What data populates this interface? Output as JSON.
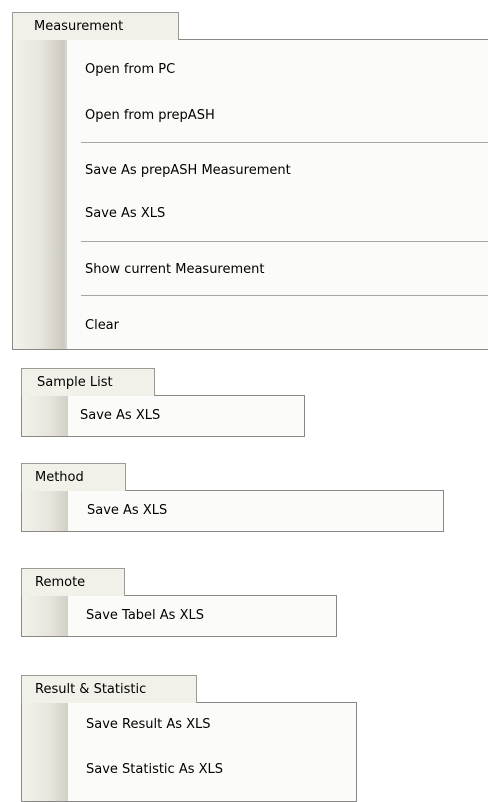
{
  "measurement_menu": {
    "title": "Measurement",
    "items": [
      "Open from PC",
      "Open from prepASH",
      "Save As  prepASH Measurement",
      "Save As XLS",
      "Show current Measurement",
      "Clear"
    ]
  },
  "sample_list_menu": {
    "title": "Sample List",
    "items": [
      "Save As XLS"
    ]
  },
  "method_menu": {
    "title": "Method",
    "items": [
      "Save As XLS"
    ]
  },
  "remote_menu": {
    "title": "Remote",
    "items": [
      "Save Tabel As XLS"
    ]
  },
  "result_statistic_menu": {
    "title": "Result & Statistic",
    "items": [
      "Save Result As XLS",
      "Save Statistic As XLS"
    ]
  },
  "colors": {
    "tab_background": "#f1f0e9",
    "menu_background": "#fbfbf9",
    "border": "#8a8884",
    "separator": "#a9a7a1"
  }
}
